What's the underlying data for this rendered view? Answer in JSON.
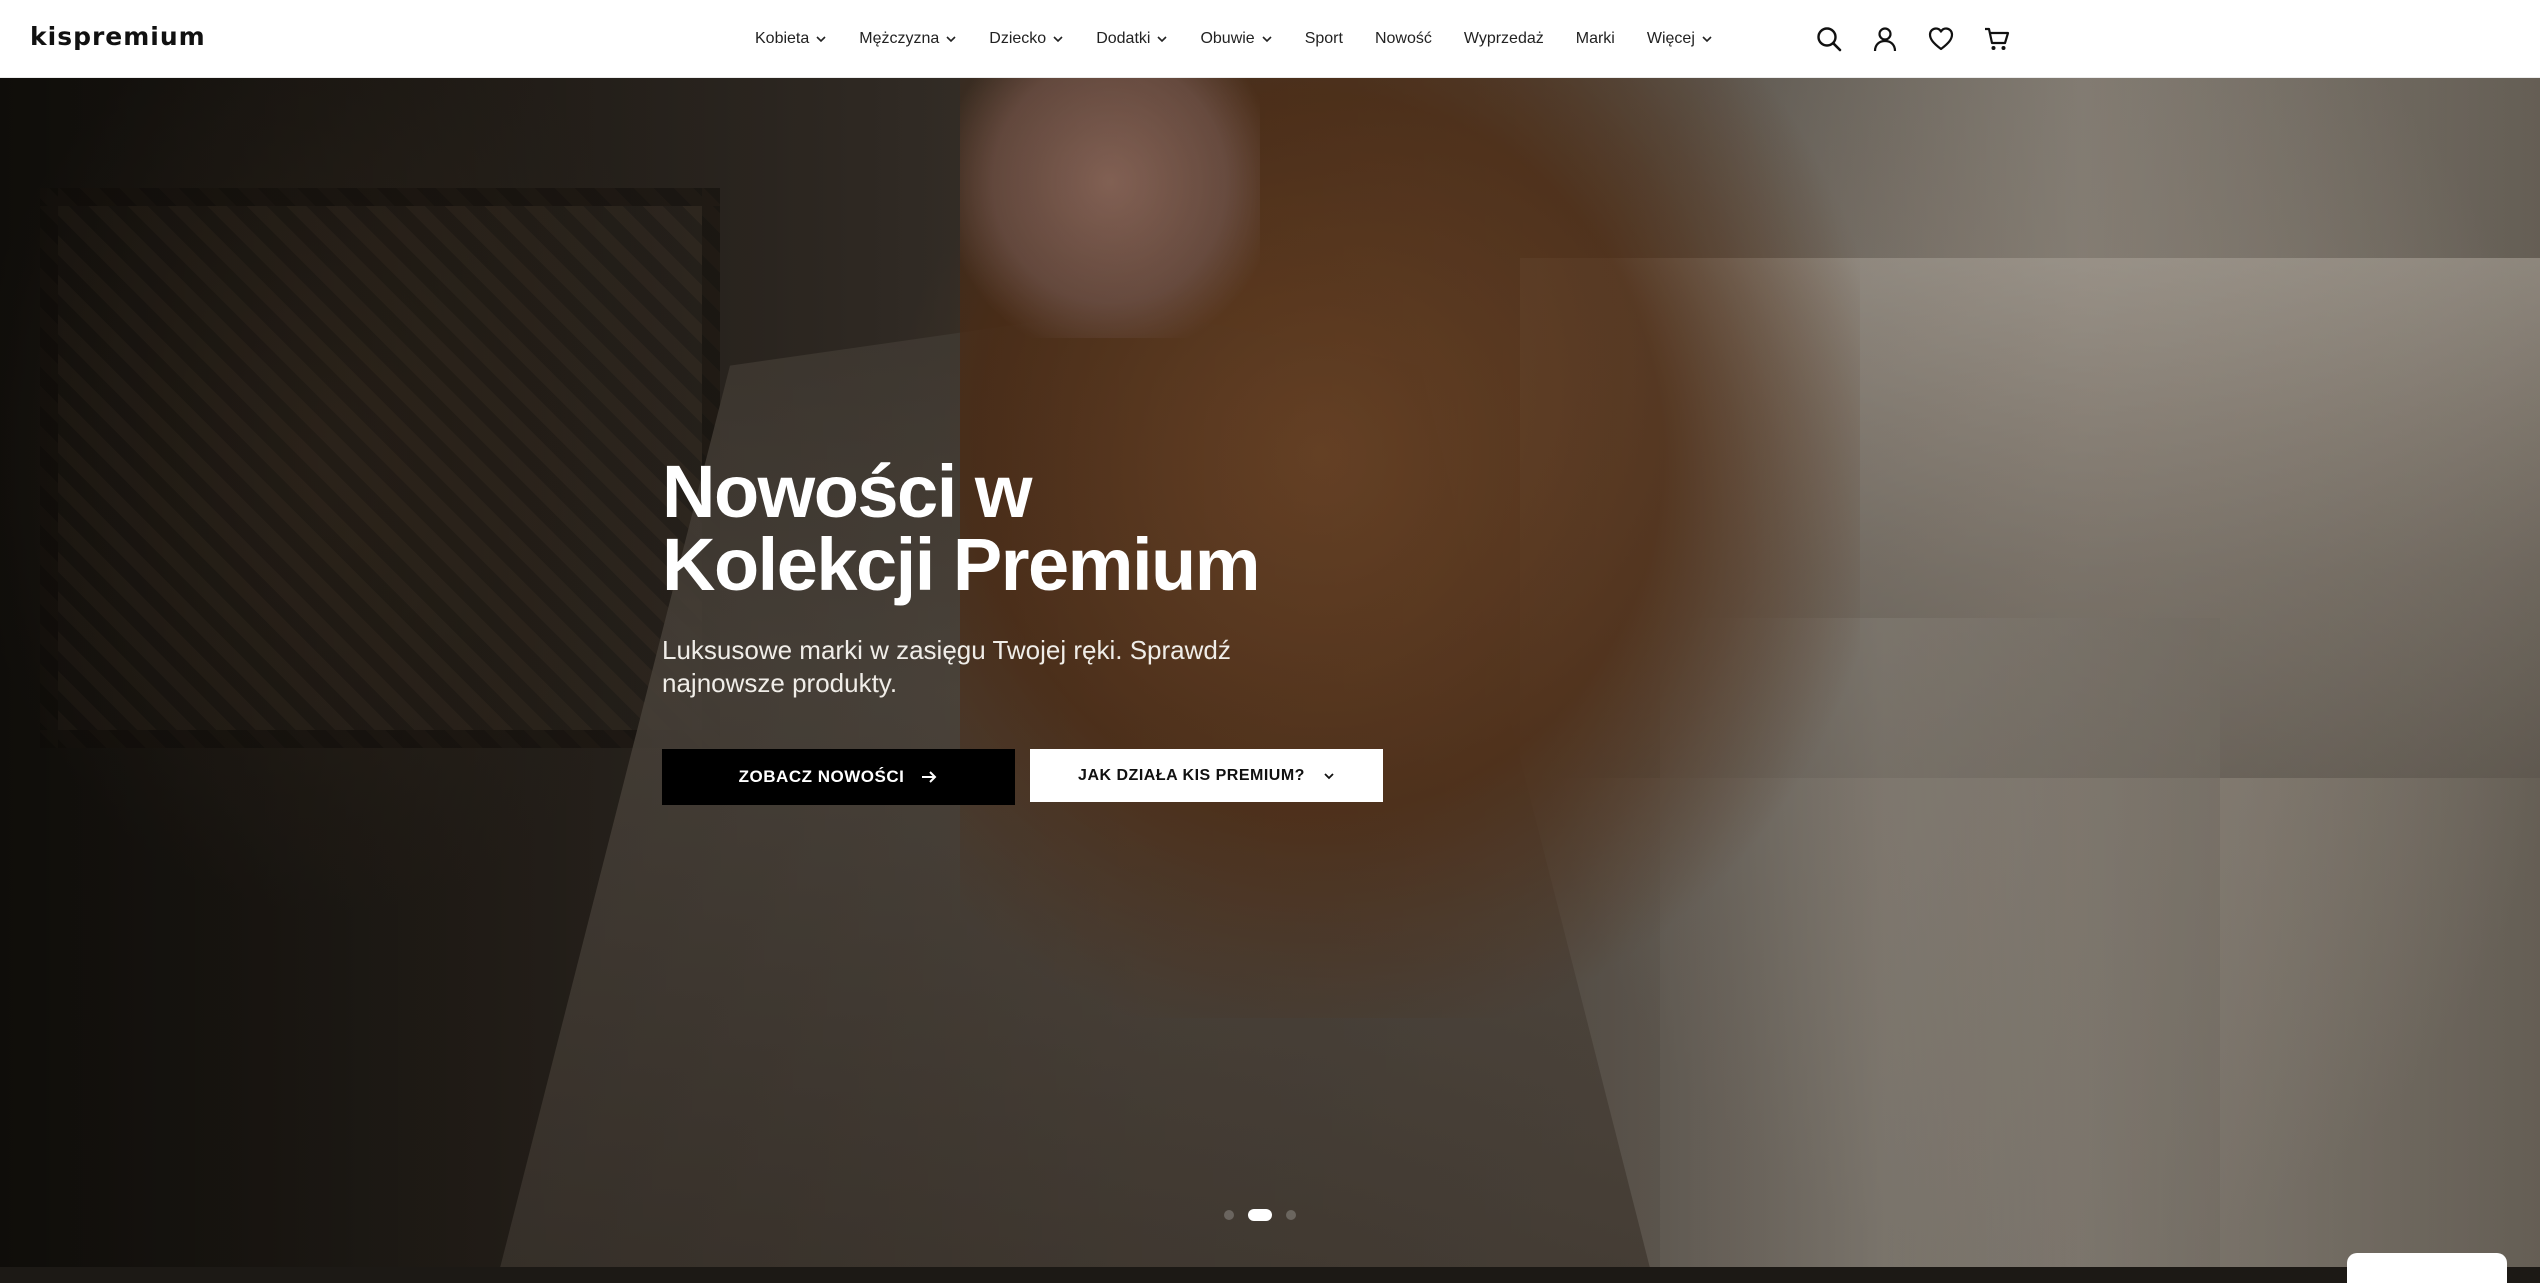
{
  "header": {
    "logo": "kispremium",
    "nav": [
      {
        "label": "Kobieta",
        "dropdown": true
      },
      {
        "label": "Mężczyzna",
        "dropdown": true
      },
      {
        "label": "Dziecko",
        "dropdown": true
      },
      {
        "label": "Dodatki",
        "dropdown": true
      },
      {
        "label": "Obuwie",
        "dropdown": true
      },
      {
        "label": "Sport",
        "dropdown": false
      },
      {
        "label": "Nowość",
        "dropdown": false
      },
      {
        "label": "Wyprzedaż",
        "dropdown": false
      },
      {
        "label": "Marki",
        "dropdown": false
      },
      {
        "label": "Więcej",
        "dropdown": true
      }
    ],
    "icons": [
      "search-icon",
      "account-icon",
      "wishlist-icon",
      "cart-icon"
    ]
  },
  "hero": {
    "title_line1": "Nowości w",
    "title_line2": "Kolekcji Premium",
    "subtitle": "Luksusowe marki w zasięgu Twojej ręki. Sprawdź najnowsze produkty.",
    "primary_button": "ZOBACZ NOWOŚCI",
    "secondary_button": "JAK DZIAŁA KIS PREMIUM?",
    "slides_count": 3,
    "active_slide": 2
  },
  "colors": {
    "header_bg": "#ffffff",
    "primary_button_bg": "#000000",
    "secondary_button_bg": "#ffffff",
    "hero_text": "#ffffff"
  }
}
